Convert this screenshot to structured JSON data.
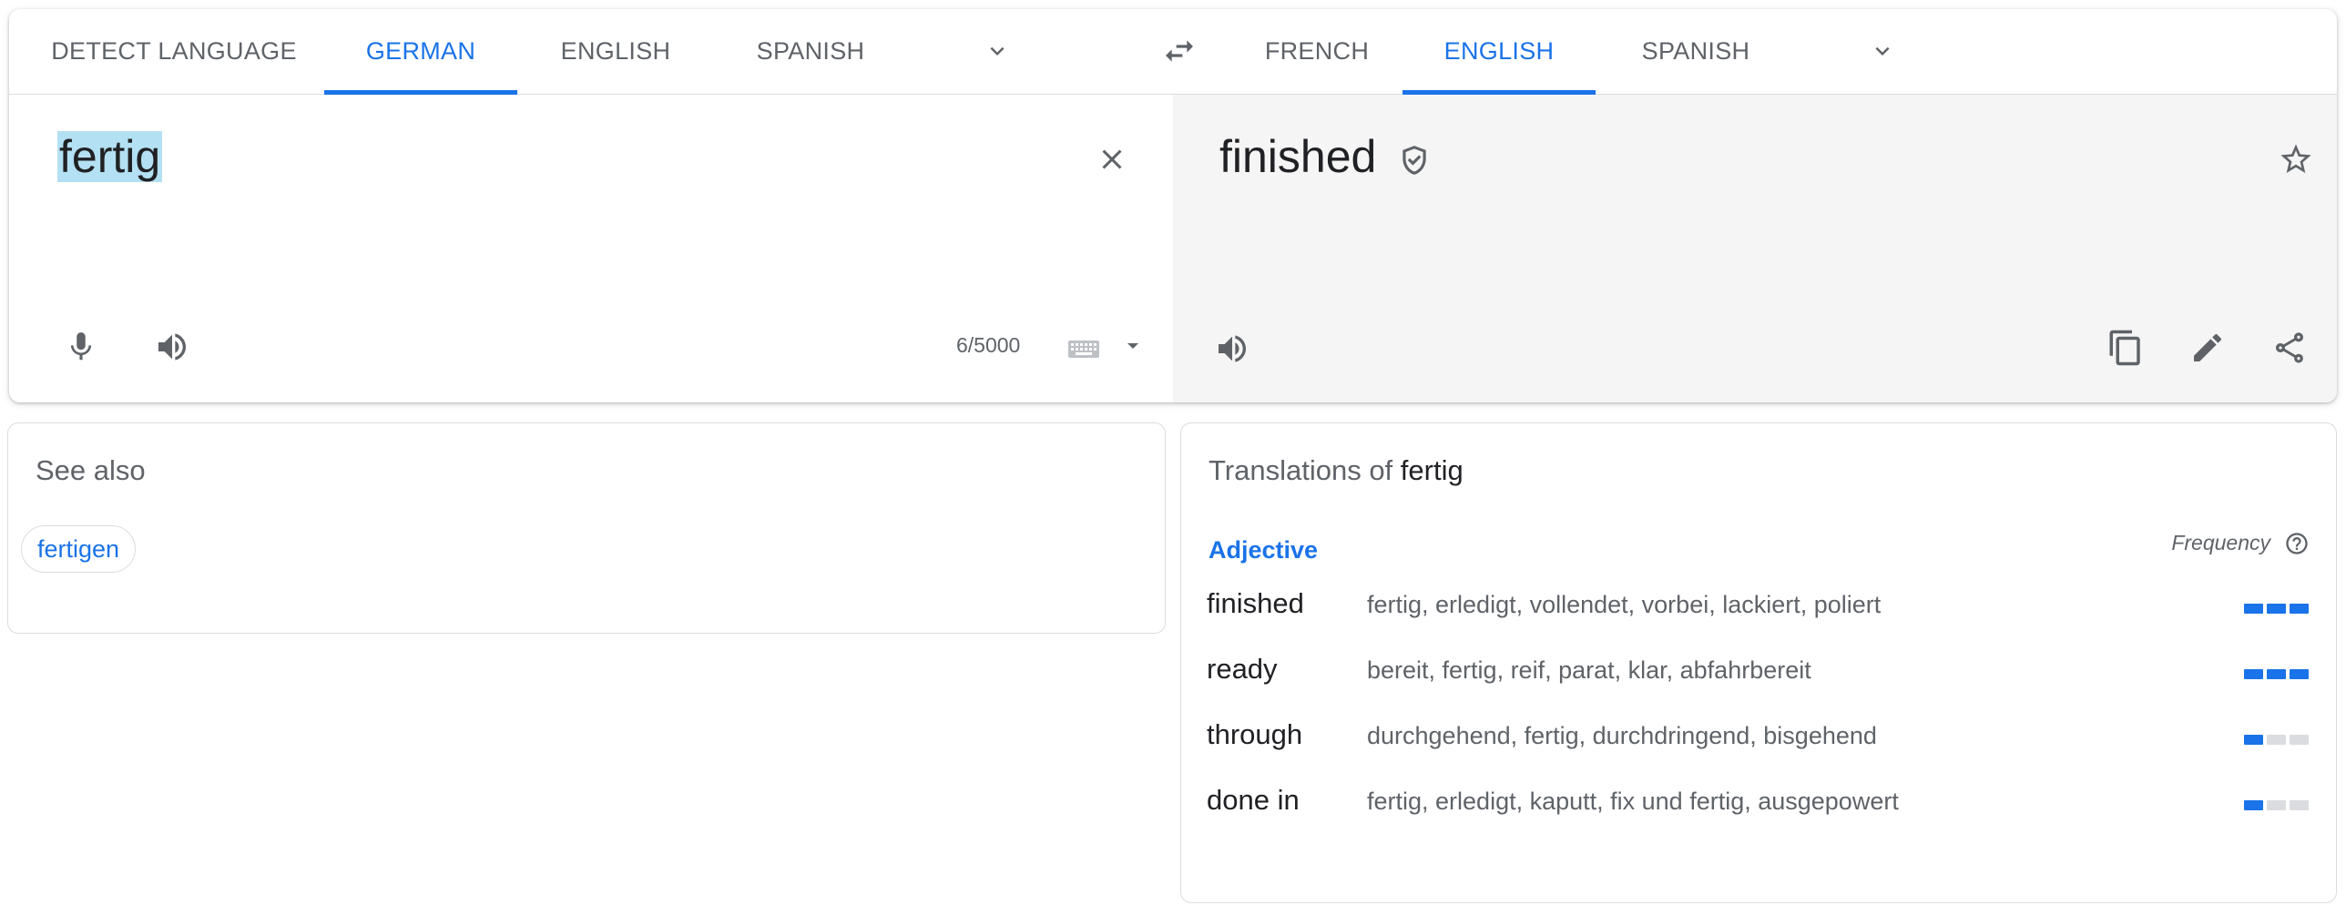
{
  "source_tabs": [
    {
      "label": "DETECT LANGUAGE",
      "active": false
    },
    {
      "label": "GERMAN",
      "active": true
    },
    {
      "label": "ENGLISH",
      "active": false
    },
    {
      "label": "SPANISH",
      "active": false
    }
  ],
  "target_tabs": [
    {
      "label": "FRENCH",
      "active": false
    },
    {
      "label": "ENGLISH",
      "active": true
    },
    {
      "label": "SPANISH",
      "active": false
    }
  ],
  "source": {
    "text": "fertig",
    "char_count": "6/5000"
  },
  "target": {
    "text": "finished"
  },
  "icons": {
    "more_source": "chevron-down-icon",
    "swap": "swap-icon",
    "more_target": "chevron-down-icon",
    "clear": "close-icon",
    "mic": "microphone-icon",
    "listen_source": "speaker-icon",
    "keyboard": "keyboard-icon",
    "keyboard_menu": "dropdown-arrow-icon",
    "verified": "shield-check-icon",
    "star": "star-icon",
    "listen_target": "speaker-icon",
    "copy": "copy-icon",
    "edit": "pencil-icon",
    "share": "share-icon",
    "help": "help-circle-icon"
  },
  "see_also": {
    "title": "See also",
    "chips": [
      "fertigen"
    ]
  },
  "translations": {
    "title_prefix": "Translations of",
    "title_word": "fertig",
    "part_of_speech": "Adjective",
    "frequency_label": "Frequency",
    "rows": [
      {
        "word": "finished",
        "synonyms": "fertig, erledigt, vollendet, vorbei, lackiert, poliert",
        "frequency": 3
      },
      {
        "word": "ready",
        "synonyms": "bereit, fertig, reif, parat, klar, abfahrbereit",
        "frequency": 3
      },
      {
        "word": "through",
        "synonyms": "durchgehend, fertig, durchdringend, bisgehend",
        "frequency": 1
      },
      {
        "word": "done in",
        "synonyms": "fertig, erledigt, kaputt, fix und fertig, ausgepowert",
        "frequency": 1
      }
    ]
  },
  "colors": {
    "accent": "#1a73e8",
    "text_secondary": "#5f6368",
    "selection": "#b3e0f2",
    "target_bg": "#f5f5f5",
    "freq_off": "#dadce0"
  }
}
